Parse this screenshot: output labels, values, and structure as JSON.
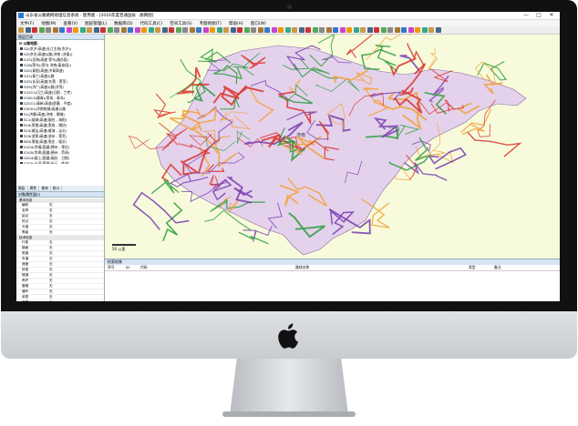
{
  "window": {
    "title": "山东省公路路网地理信息系统 · 使用版 - [2016年度普通国省 · 路网图]",
    "minimize": "—",
    "maximize": "□",
    "close": "✕"
  },
  "menu": [
    "文件(F)",
    "地图(M)",
    "查看(V)",
    "图层管理(L)",
    "数据库(D)",
    "代码工具(C)",
    "空间工具(S)",
    "专题地图(T)",
    "帮助(H)",
    "窗口(W)"
  ],
  "left_panel": {
    "header": "图层目录",
    "tree_root": "公路地图",
    "tree_items": [
      "G2(京沪)高速(长江主线(京沪))",
      "G3(京台)高速公路(济南 (济泰))",
      "G15(沈海)高速 荣乌(烟台段)",
      "G18(荣乌)(荣乌 济南(泰安段))",
      "G20(青银)高速(济青高速)",
      "G22(青兰)高速公路",
      "G25(长深)高速(东营 - 莱芜)",
      "G35(济广)高速公路(济菏)",
      "G1511(日兰)高速(日照 - 兰考)",
      "G1813(威青)(荣成 - 青岛)",
      "G2011(青新)高速(即墨 - 平度)",
      "G3001(济南绕城)高速公路",
      "S1(济聊)高速(济南 - 聊城)",
      "S11(烟海)高速(烟台 - 海阳)",
      "S16(荣潍)高速(荣成 - 潍坊)",
      "S24(威汕)高速(威海 - 汕头)",
      "S29(滨莱)高速(滨州 - 莱芜)",
      "S83(枣临)高速(枣庄 - 临沂)",
      "G104(京福)国道(德州 - 枣庄)",
      "G105(京珠)国道(德州 - 菏泽)",
      "G204(烟上)国道(烟台 - 日照)",
      "G205(山深)国道(庆云 - 临沭)",
      "G206(烟汕)国道(烟台 - 台儿庄)",
      "G220(东郑)国道(东营 - 郑州)"
    ],
    "tabs": [
      "图层",
      "属性",
      "查询",
      "统计"
    ]
  },
  "properties": {
    "header": "对象属性窗口",
    "groups": [
      {
        "name": "基本信息",
        "rows": [
          {
            "k": "编码",
            "v": "无"
          },
          {
            "k": "名称",
            "v": "无"
          },
          {
            "k": "起点",
            "v": "无"
          },
          {
            "k": "终点",
            "v": "无"
          },
          {
            "k": "长度",
            "v": "无"
          },
          {
            "k": "等级",
            "v": "无"
          }
        ]
      },
      {
        "name": "技术信息",
        "rows": [
          {
            "k": "行政",
            "v": "无"
          },
          {
            "k": "路面",
            "v": "无"
          },
          {
            "k": "宽度",
            "v": "无"
          },
          {
            "k": "车道",
            "v": "无"
          },
          {
            "k": "速度",
            "v": "无"
          },
          {
            "k": "桥梁",
            "v": "无"
          },
          {
            "k": "隧道",
            "v": "无"
          },
          {
            "k": "养护",
            "v": "无"
          },
          {
            "k": "管辖",
            "v": "无"
          },
          {
            "k": "通车",
            "v": "无"
          },
          {
            "k": "收费",
            "v": "无"
          },
          {
            "k": "改建",
            "v": "无"
          },
          {
            "k": "年份",
            "v": "无"
          },
          {
            "k": "状态",
            "v": "无"
          },
          {
            "k": "备注",
            "v": "无"
          },
          {
            "k": "其它",
            "v": "无"
          }
        ]
      }
    ]
  },
  "map": {
    "scale_label": "50 公里",
    "city_label": "济南",
    "land_color": "#e4d2ec",
    "bg_color": "#f7fbdc",
    "road_colors": [
      "#d9342b",
      "#2e9e3e",
      "#f2a23c",
      "#7a3fb0"
    ]
  },
  "bottom_panel": {
    "header": "检索结果",
    "columns": [
      "序号",
      "ID",
      "代码",
      "路线名称",
      "类型",
      "备注"
    ]
  }
}
